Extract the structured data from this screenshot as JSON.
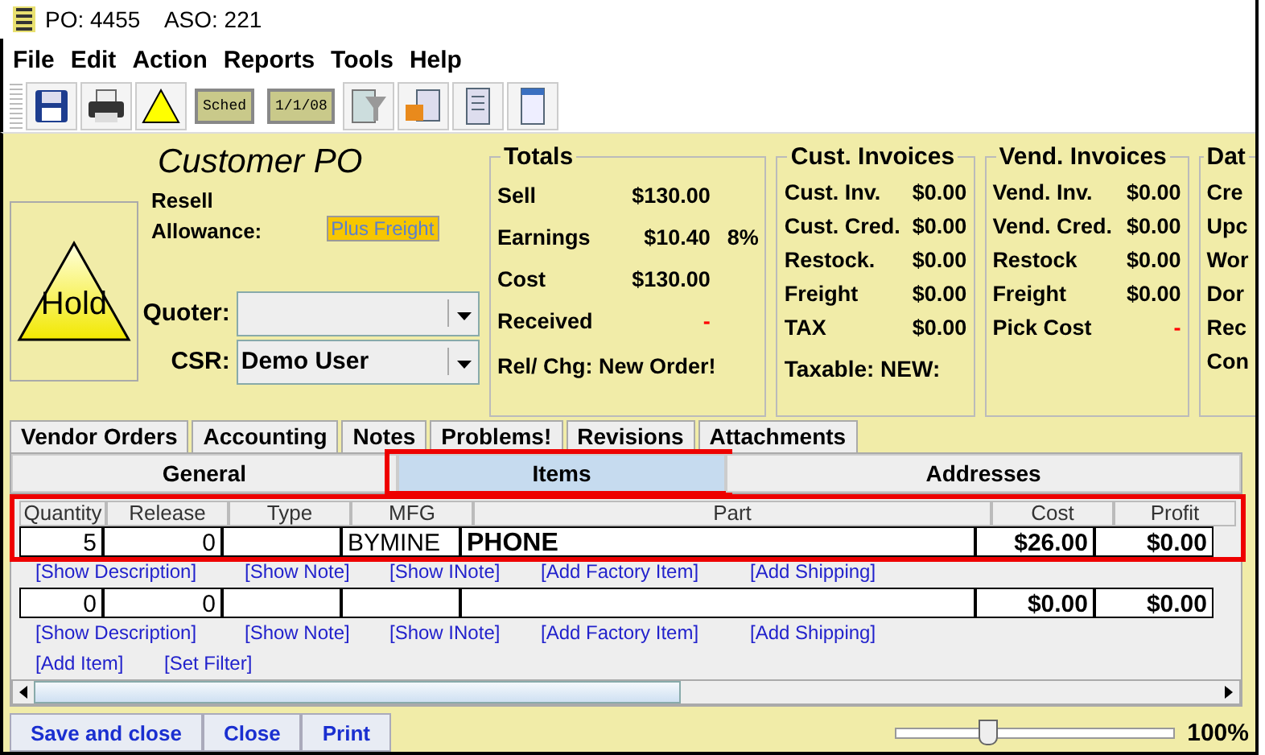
{
  "window": {
    "title": "PO: 4455    ASO: 221"
  },
  "menu": [
    "File",
    "Edit",
    "Action",
    "Reports",
    "Tools",
    "Help"
  ],
  "toolbar": [
    {
      "kind": "save"
    },
    {
      "kind": "print"
    },
    {
      "kind": "warning"
    },
    {
      "kind": "text",
      "label": "Sched"
    },
    {
      "kind": "text",
      "label": "1/1/08"
    },
    {
      "kind": "filter"
    },
    {
      "kind": "box"
    },
    {
      "kind": "doc"
    },
    {
      "kind": "table"
    }
  ],
  "header": {
    "title": "Customer PO",
    "resell_label": "Resell",
    "allowance_label": "Allowance:",
    "allowance_value": "Plus Freight",
    "status": "Hold",
    "quoter": {
      "label": "Quoter:"
    },
    "csr": {
      "label": "CSR:",
      "value": "Demo User"
    }
  },
  "panels": [
    {
      "title": "Totals",
      "rows": [
        {
          "label": "Sell",
          "value": "$130.00"
        },
        {
          "label": "Earnings",
          "value": "$10.40",
          "extra": "8%"
        },
        {
          "label": "Cost",
          "value": "$130.00"
        },
        {
          "label": "Received",
          "value": "-"
        }
      ],
      "footer": "Rel/ Chg: New Order!"
    },
    {
      "title": "Cust. Invoices",
      "rows": [
        {
          "label": "Cust. Inv.",
          "value": "$0.00"
        },
        {
          "label": "Cust. Cred.",
          "value": "$0.00"
        },
        {
          "label": "Restock.",
          "value": "$0.00"
        },
        {
          "label": "Freight",
          "value": "$0.00"
        },
        {
          "label": "TAX",
          "value": "$0.00"
        }
      ],
      "footer": "Taxable: NEW:"
    },
    {
      "title": "Vend. Invoices",
      "rows": [
        {
          "label": "Vend. Inv.",
          "value": "$0.00"
        },
        {
          "label": "Vend. Cred.",
          "value": "$0.00"
        },
        {
          "label": "Restock",
          "value": "$0.00"
        },
        {
          "label": "Freight",
          "value": "$0.00"
        },
        {
          "label": "Pick Cost",
          "value": "-"
        }
      ]
    },
    {
      "title": "Dat",
      "rows": [
        {
          "label": "Cre"
        },
        {
          "label": "Upc"
        },
        {
          "label": "Wor"
        },
        {
          "label": "Dor"
        },
        {
          "label": "Rec"
        },
        {
          "label": "Con"
        }
      ]
    }
  ],
  "tabs": [
    {
      "label": "Vendor Orders",
      "selected": false
    },
    {
      "label": "Accounting",
      "selected": false
    },
    {
      "label": "Notes",
      "selected": false
    },
    {
      "label": "Problems!",
      "selected": false
    },
    {
      "label": "Revisions",
      "selected": false
    },
    {
      "label": "Attachments",
      "selected": false
    }
  ],
  "subtabs": [
    {
      "label": "General",
      "selected": false,
      "highlighted": false
    },
    {
      "label": "Items",
      "selected": true,
      "highlighted": true
    },
    {
      "label": "Addresses",
      "selected": false,
      "highlighted": false
    }
  ],
  "table": {
    "columns": [
      "Quantity",
      "Release",
      "Type",
      "MFG",
      "Part",
      "Cost",
      "Profit"
    ],
    "rows": [
      {
        "cells": [
          "5",
          "0",
          "",
          "BYMINE",
          "PHONE",
          "$26.00",
          "$0.00"
        ],
        "highlighted": true,
        "links": [
          "[Show Description]",
          "[Show Note]",
          "[Show INote]",
          "[Add Factory Item]",
          "[Add Shipping]"
        ]
      },
      {
        "cells": [
          "0",
          "0",
          "",
          "",
          "",
          "$0.00",
          "$0.00"
        ],
        "highlighted": false,
        "links": [
          "[Show Description]",
          "[Show Note]",
          "[Show INote]",
          "[Add Factory Item]",
          "[Add Shipping]"
        ]
      }
    ],
    "actions": [
      "[Add Item]",
      "[Set Filter]"
    ]
  },
  "buttons": [
    "Save and close",
    "Close",
    "Print"
  ],
  "zoom": {
    "level": 0.33,
    "reading": "100%"
  }
}
